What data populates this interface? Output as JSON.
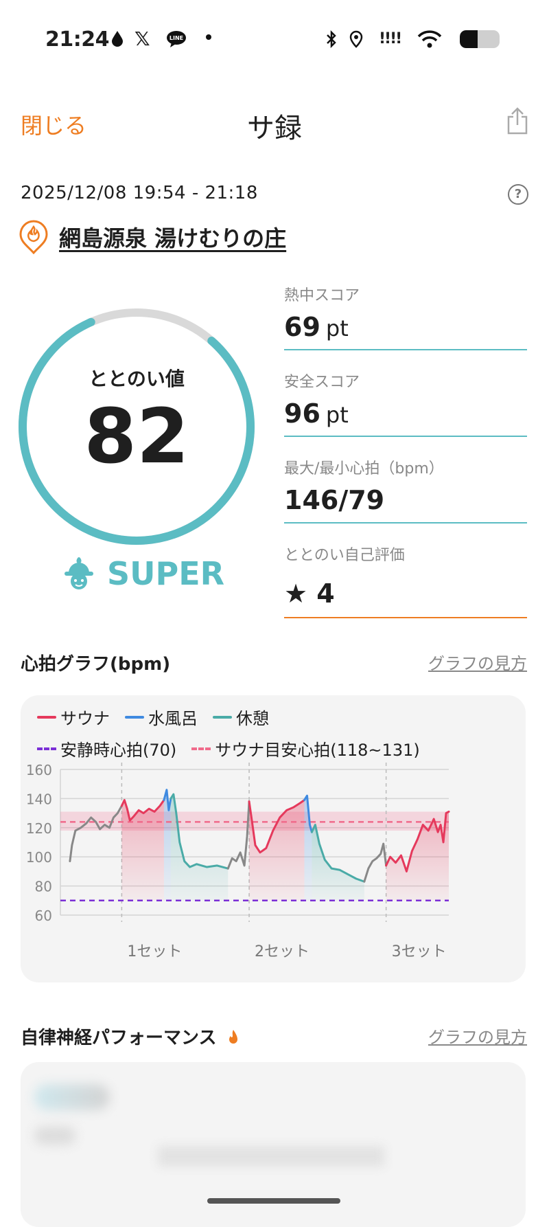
{
  "status_bar": {
    "time": "21:24",
    "signal_text": "!!!!",
    "battery_level": 0.45
  },
  "header": {
    "close_label": "閉じる",
    "title": "サ録"
  },
  "session": {
    "datetime": "2025/12/08 19:54 - 21:18",
    "facility": "網島源泉 湯けむりの庄"
  },
  "gauge": {
    "label": "ととのい値",
    "value": "82",
    "max": 100,
    "rank": "SUPER"
  },
  "stats": [
    {
      "label": "熱中スコア",
      "value": "69",
      "unit": "pt"
    },
    {
      "label": "安全スコア",
      "value": "96",
      "unit": "pt"
    },
    {
      "label": "最大/最小心拍（bpm）",
      "value": "146/79",
      "unit": ""
    },
    {
      "label": "ととのい自己評価",
      "value": "★ 4",
      "unit": ""
    }
  ],
  "hr_section": {
    "title": "心拍グラフ(bpm)",
    "link": "グラフの見方"
  },
  "anf_section": {
    "title": "自律神経パフォーマンス",
    "link": "グラフの見方"
  },
  "colors": {
    "accent": "#ee7d22",
    "teal": "#5bbcc3",
    "sauna": "#e5395c",
    "water": "#3f8ae0",
    "rest": "#4aaba7",
    "resting_line": "#7b2fd6",
    "sauna_target": "#f06b8b",
    "other": "#888888"
  },
  "chart_data": {
    "type": "line",
    "legend": [
      {
        "name": "サウナ",
        "color": "#e5395c",
        "style": "solid"
      },
      {
        "name": "水風呂",
        "color": "#3f8ae0",
        "style": "solid"
      },
      {
        "name": "休憩",
        "color": "#4aaba7",
        "style": "solid"
      },
      {
        "name": "安静時心拍(70)",
        "color": "#7b2fd6",
        "style": "dashed"
      },
      {
        "name": "サウナ目安心拍(118~131)",
        "color": "#f06b8b",
        "style": "dashed"
      }
    ],
    "ylim": [
      60,
      160
    ],
    "yticks": [
      160,
      140,
      120,
      100,
      80,
      60
    ],
    "x_range": [
      0,
      570
    ],
    "set_markers": [
      {
        "x": 90,
        "label": "1セット"
      },
      {
        "x": 277,
        "label": "2セット"
      },
      {
        "x": 478,
        "label": "3セット"
      }
    ],
    "resting_hr": 70,
    "target_band": [
      118,
      131
    ],
    "target_line": 124,
    "series": [
      {
        "phase": "other",
        "points": [
          [
            14,
            97
          ],
          [
            17,
            108
          ],
          [
            22,
            118
          ],
          [
            30,
            120
          ],
          [
            38,
            123
          ],
          [
            45,
            127
          ],
          [
            52,
            124
          ],
          [
            58,
            119
          ],
          [
            65,
            122
          ],
          [
            72,
            120
          ],
          [
            78,
            127
          ],
          [
            84,
            130
          ],
          [
            90,
            135
          ]
        ]
      },
      {
        "phase": "sauna",
        "points": [
          [
            90,
            135
          ],
          [
            94,
            139
          ],
          [
            98,
            133
          ],
          [
            102,
            125
          ],
          [
            108,
            128
          ],
          [
            115,
            132
          ],
          [
            122,
            130
          ],
          [
            130,
            133
          ],
          [
            138,
            131
          ],
          [
            146,
            135
          ],
          [
            152,
            139
          ]
        ]
      },
      {
        "phase": "water",
        "points": [
          [
            152,
            139
          ],
          [
            156,
            146
          ],
          [
            159,
            132
          ],
          [
            162,
            140
          ]
        ]
      },
      {
        "phase": "rest",
        "points": [
          [
            162,
            140
          ],
          [
            166,
            143
          ],
          [
            170,
            130
          ],
          [
            175,
            110
          ],
          [
            182,
            97
          ],
          [
            190,
            93
          ],
          [
            200,
            95
          ],
          [
            215,
            93
          ],
          [
            230,
            94
          ],
          [
            246,
            92
          ]
        ]
      },
      {
        "phase": "other",
        "points": [
          [
            246,
            92
          ],
          [
            252,
            99
          ],
          [
            258,
            97
          ],
          [
            264,
            103
          ],
          [
            270,
            94
          ],
          [
            274,
            114
          ],
          [
            277,
            138
          ]
        ]
      },
      {
        "phase": "sauna",
        "points": [
          [
            277,
            138
          ],
          [
            281,
            125
          ],
          [
            286,
            108
          ],
          [
            293,
            103
          ],
          [
            302,
            106
          ],
          [
            312,
            118
          ],
          [
            322,
            127
          ],
          [
            332,
            132
          ],
          [
            342,
            134
          ],
          [
            352,
            137
          ],
          [
            358,
            139
          ]
        ]
      },
      {
        "phase": "water",
        "points": [
          [
            358,
            139
          ],
          [
            362,
            142
          ],
          [
            366,
            122
          ],
          [
            369,
            117
          ]
        ]
      },
      {
        "phase": "rest",
        "points": [
          [
            369,
            117
          ],
          [
            374,
            122
          ],
          [
            380,
            109
          ],
          [
            388,
            98
          ],
          [
            398,
            92
          ],
          [
            410,
            91
          ],
          [
            422,
            88
          ],
          [
            434,
            85
          ],
          [
            446,
            83
          ]
        ]
      },
      {
        "phase": "other",
        "points": [
          [
            446,
            83
          ],
          [
            452,
            92
          ],
          [
            458,
            97
          ],
          [
            464,
            99
          ],
          [
            470,
            102
          ],
          [
            474,
            109
          ],
          [
            478,
            94
          ]
        ]
      },
      {
        "phase": "sauna",
        "points": [
          [
            478,
            94
          ],
          [
            484,
            100
          ],
          [
            492,
            96
          ],
          [
            500,
            101
          ],
          [
            508,
            90
          ],
          [
            516,
            104
          ],
          [
            524,
            112
          ],
          [
            532,
            122
          ],
          [
            540,
            118
          ],
          [
            548,
            126
          ],
          [
            554,
            117
          ],
          [
            558,
            122
          ],
          [
            562,
            110
          ],
          [
            566,
            130
          ],
          [
            570,
            131
          ]
        ]
      }
    ]
  }
}
